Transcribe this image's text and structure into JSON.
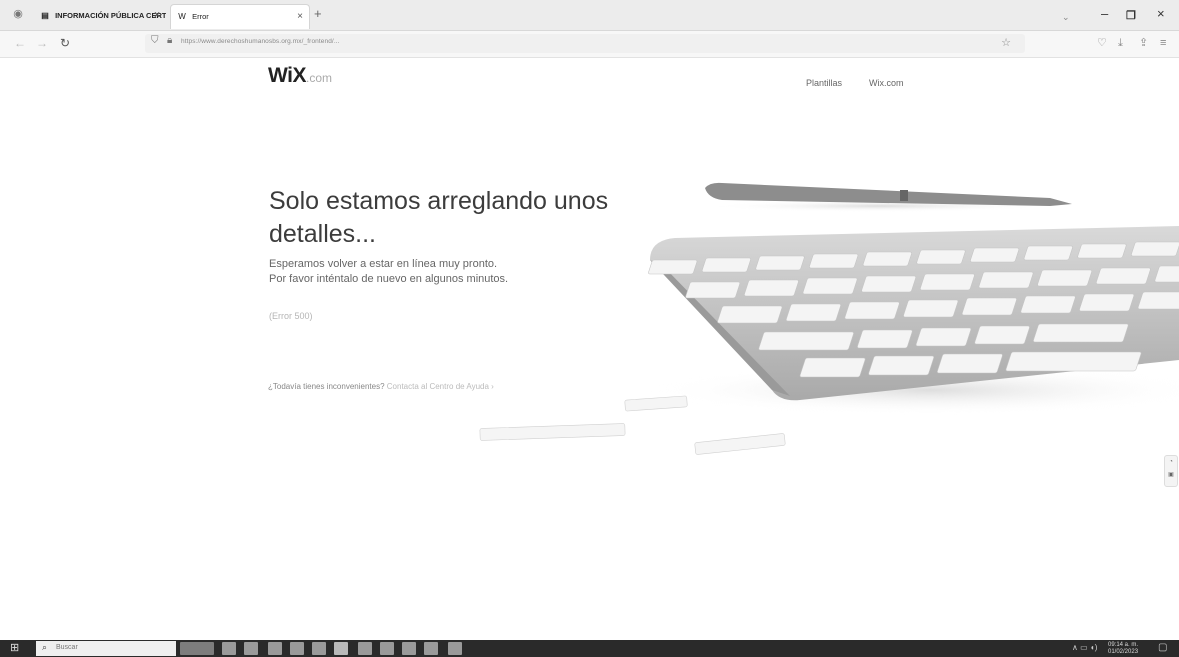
{
  "browser": {
    "tabs": [
      {
        "label": "INFORMACIÓN PÚBLICA CERT",
        "favicon": "document-icon",
        "active": false
      },
      {
        "label": "Error",
        "favicon": "wix-icon",
        "active": true
      }
    ],
    "tab_close_glyph": "×",
    "new_tab_glyph": "+",
    "url": "https://www.derechoshumanosbs.org.mx/_frontend/...",
    "window_controls": {
      "minimize": "–",
      "maximize": "❐",
      "close": "×"
    }
  },
  "page": {
    "logo": {
      "brand": "WiX",
      "suffix": ".com"
    },
    "nav": {
      "templates": "Plantillas",
      "wixcom": "Wix.com"
    },
    "headline": "Solo estamos arreglando unos detalles...",
    "subtext_line1": "Esperamos volver a estar en línea muy pronto.",
    "subtext_line2": "Por favor inténtalo de nuevo en algunos minutos.",
    "error_code": "(Error 500)",
    "help_question": "¿Todavía tienes inconvenientes?",
    "help_link": "Contacta al Centro de Ayuda ›"
  },
  "taskbar": {
    "search_placeholder": "Buscar",
    "clock_time": "09:14 a. m.",
    "clock_date": "01/02/2023"
  },
  "colors": {
    "headline": "#3c3c3c",
    "taskbar": "#2a2a2a",
    "tabstrip": "#ececec"
  }
}
